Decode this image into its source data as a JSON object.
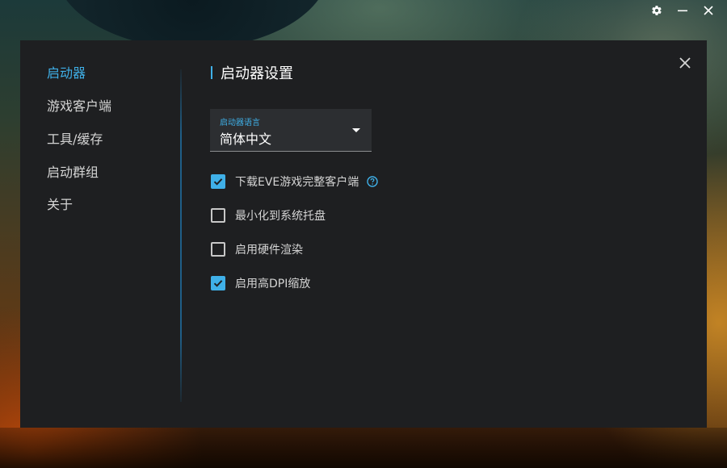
{
  "window": {
    "controls": [
      "gear-icon",
      "minimize-icon",
      "close-icon"
    ]
  },
  "sidebar": {
    "items": [
      {
        "label": "启动器",
        "active": true
      },
      {
        "label": "游戏客户端",
        "active": false
      },
      {
        "label": "工具/缓存",
        "active": false
      },
      {
        "label": "启动群组",
        "active": false
      },
      {
        "label": "关于",
        "active": false
      }
    ]
  },
  "main": {
    "title": "启动器设置",
    "language": {
      "label": "启动器语言",
      "value": "简体中文"
    },
    "options": [
      {
        "label": "下载EVE游戏完整客户端",
        "checked": true,
        "help": true
      },
      {
        "label": "最小化到系统托盘",
        "checked": false
      },
      {
        "label": "启用硬件渲染",
        "checked": false
      },
      {
        "label": "启用高DPI缩放",
        "checked": true
      }
    ]
  },
  "colors": {
    "accent": "#3fb0e8",
    "panel": "#1e1f21",
    "text": "#d4d4d4"
  }
}
